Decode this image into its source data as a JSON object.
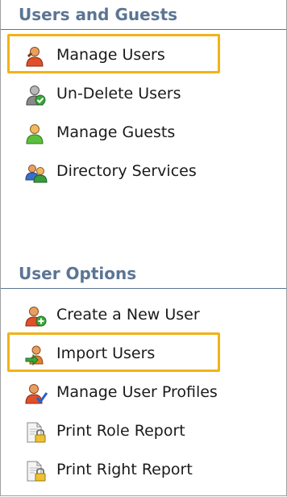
{
  "sections": [
    {
      "title": "Users and Guests",
      "items": [
        {
          "label": "Manage Users",
          "icon": "user-icon",
          "highlighted": true
        },
        {
          "label": "Un-Delete Users",
          "icon": "user-restore-icon",
          "highlighted": false
        },
        {
          "label": "Manage Guests",
          "icon": "guest-icon",
          "highlighted": false
        },
        {
          "label": "Directory Services",
          "icon": "directory-icon",
          "highlighted": false
        }
      ]
    },
    {
      "title": "User Options",
      "items": [
        {
          "label": "Create a New User",
          "icon": "user-add-icon",
          "highlighted": false
        },
        {
          "label": "Import Users",
          "icon": "user-import-icon",
          "highlighted": true
        },
        {
          "label": "Manage User Profiles",
          "icon": "user-profile-icon",
          "highlighted": false
        },
        {
          "label": "Print Role Report",
          "icon": "report-lock-icon",
          "highlighted": false
        },
        {
          "label": "Print Right Report",
          "icon": "report-lock-icon",
          "highlighted": false
        }
      ]
    }
  ],
  "colors": {
    "header_text": "#5b7594",
    "highlight": "#f2b318",
    "text": "#1a1a1a"
  }
}
